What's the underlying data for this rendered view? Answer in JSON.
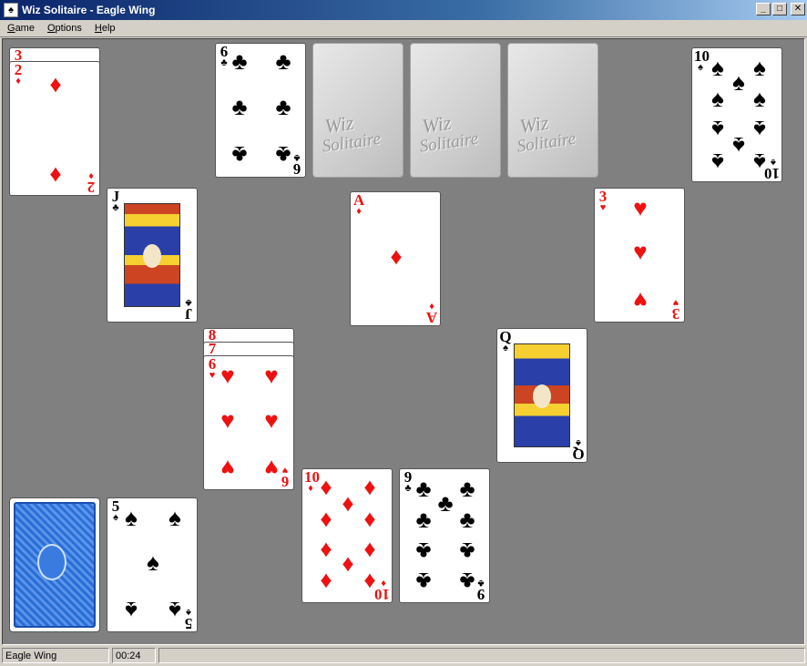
{
  "window": {
    "title": "Wiz Solitaire - Eagle Wing",
    "controls": {
      "minimize": "_",
      "maximize": "□",
      "close": "✕"
    }
  },
  "menu": [
    "Game",
    "Options",
    "Help"
  ],
  "cards": {
    "left_3_diamonds": {
      "rank": "3",
      "suit": "♦"
    },
    "left_2_diamonds": {
      "rank": "2",
      "suit": "♦"
    },
    "six_clubs": {
      "rank": "6",
      "suit": "♣"
    },
    "ten_spades": {
      "rank": "10",
      "suit": "♠"
    },
    "jack_clubs": {
      "rank": "J",
      "suit": "♣"
    },
    "ace_diamonds": {
      "rank": "A",
      "suit": "♦"
    },
    "three_hearts": {
      "rank": "3",
      "suit": "♥"
    },
    "eight_hearts": {
      "rank": "8",
      "suit": "♥"
    },
    "seven_hearts": {
      "rank": "7",
      "suit": "♥"
    },
    "six_hearts": {
      "rank": "6",
      "suit": "♥"
    },
    "queen_spades": {
      "rank": "Q",
      "suit": "♠"
    },
    "five_spades": {
      "rank": "5",
      "suit": "♠"
    },
    "ten_diamonds": {
      "rank": "10",
      "suit": "♦"
    },
    "nine_clubs": {
      "rank": "9",
      "suit": "♣"
    }
  },
  "foundation_watermark": {
    "line1": "Wiz",
    "line2": "Solitaire"
  },
  "status": {
    "game": "Eagle Wing",
    "time": "00:24",
    "message": ""
  }
}
